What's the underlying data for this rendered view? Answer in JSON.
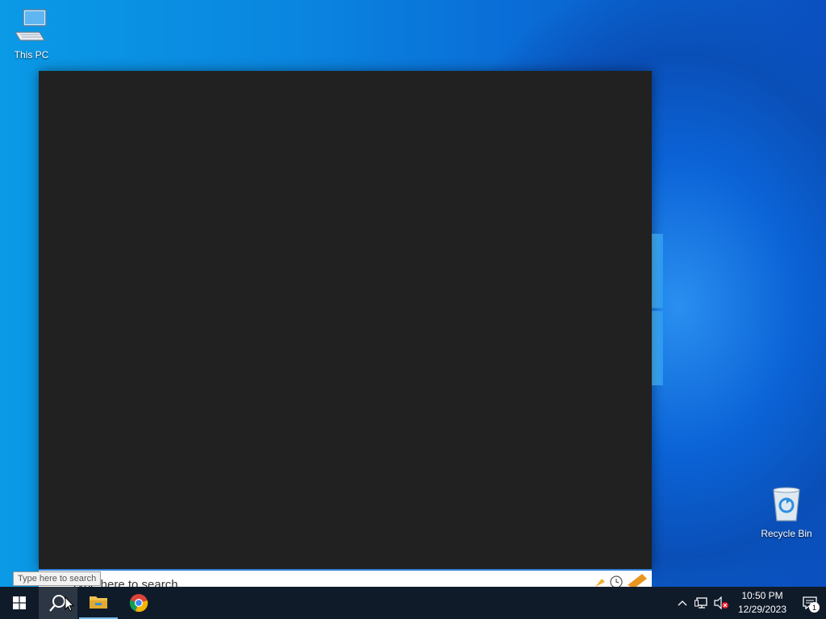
{
  "desktop": {
    "icons": [
      {
        "label": "This PC"
      },
      {
        "label": "Recycle Bin"
      }
    ]
  },
  "search_panel": {
    "placeholder": "Type here to search"
  },
  "tooltip": {
    "text": "Type here to search"
  },
  "taskbar": {
    "apps": [
      "start-icon",
      "search-icon",
      "file-explorer-icon",
      "chrome-icon"
    ],
    "tray": {
      "time": "10:50 PM",
      "date": "12/29/2023",
      "notification_count": "1"
    }
  },
  "colors": {
    "taskbar": "#101b2a",
    "window_bg": "#212121",
    "accent": "#2f7fd6"
  }
}
